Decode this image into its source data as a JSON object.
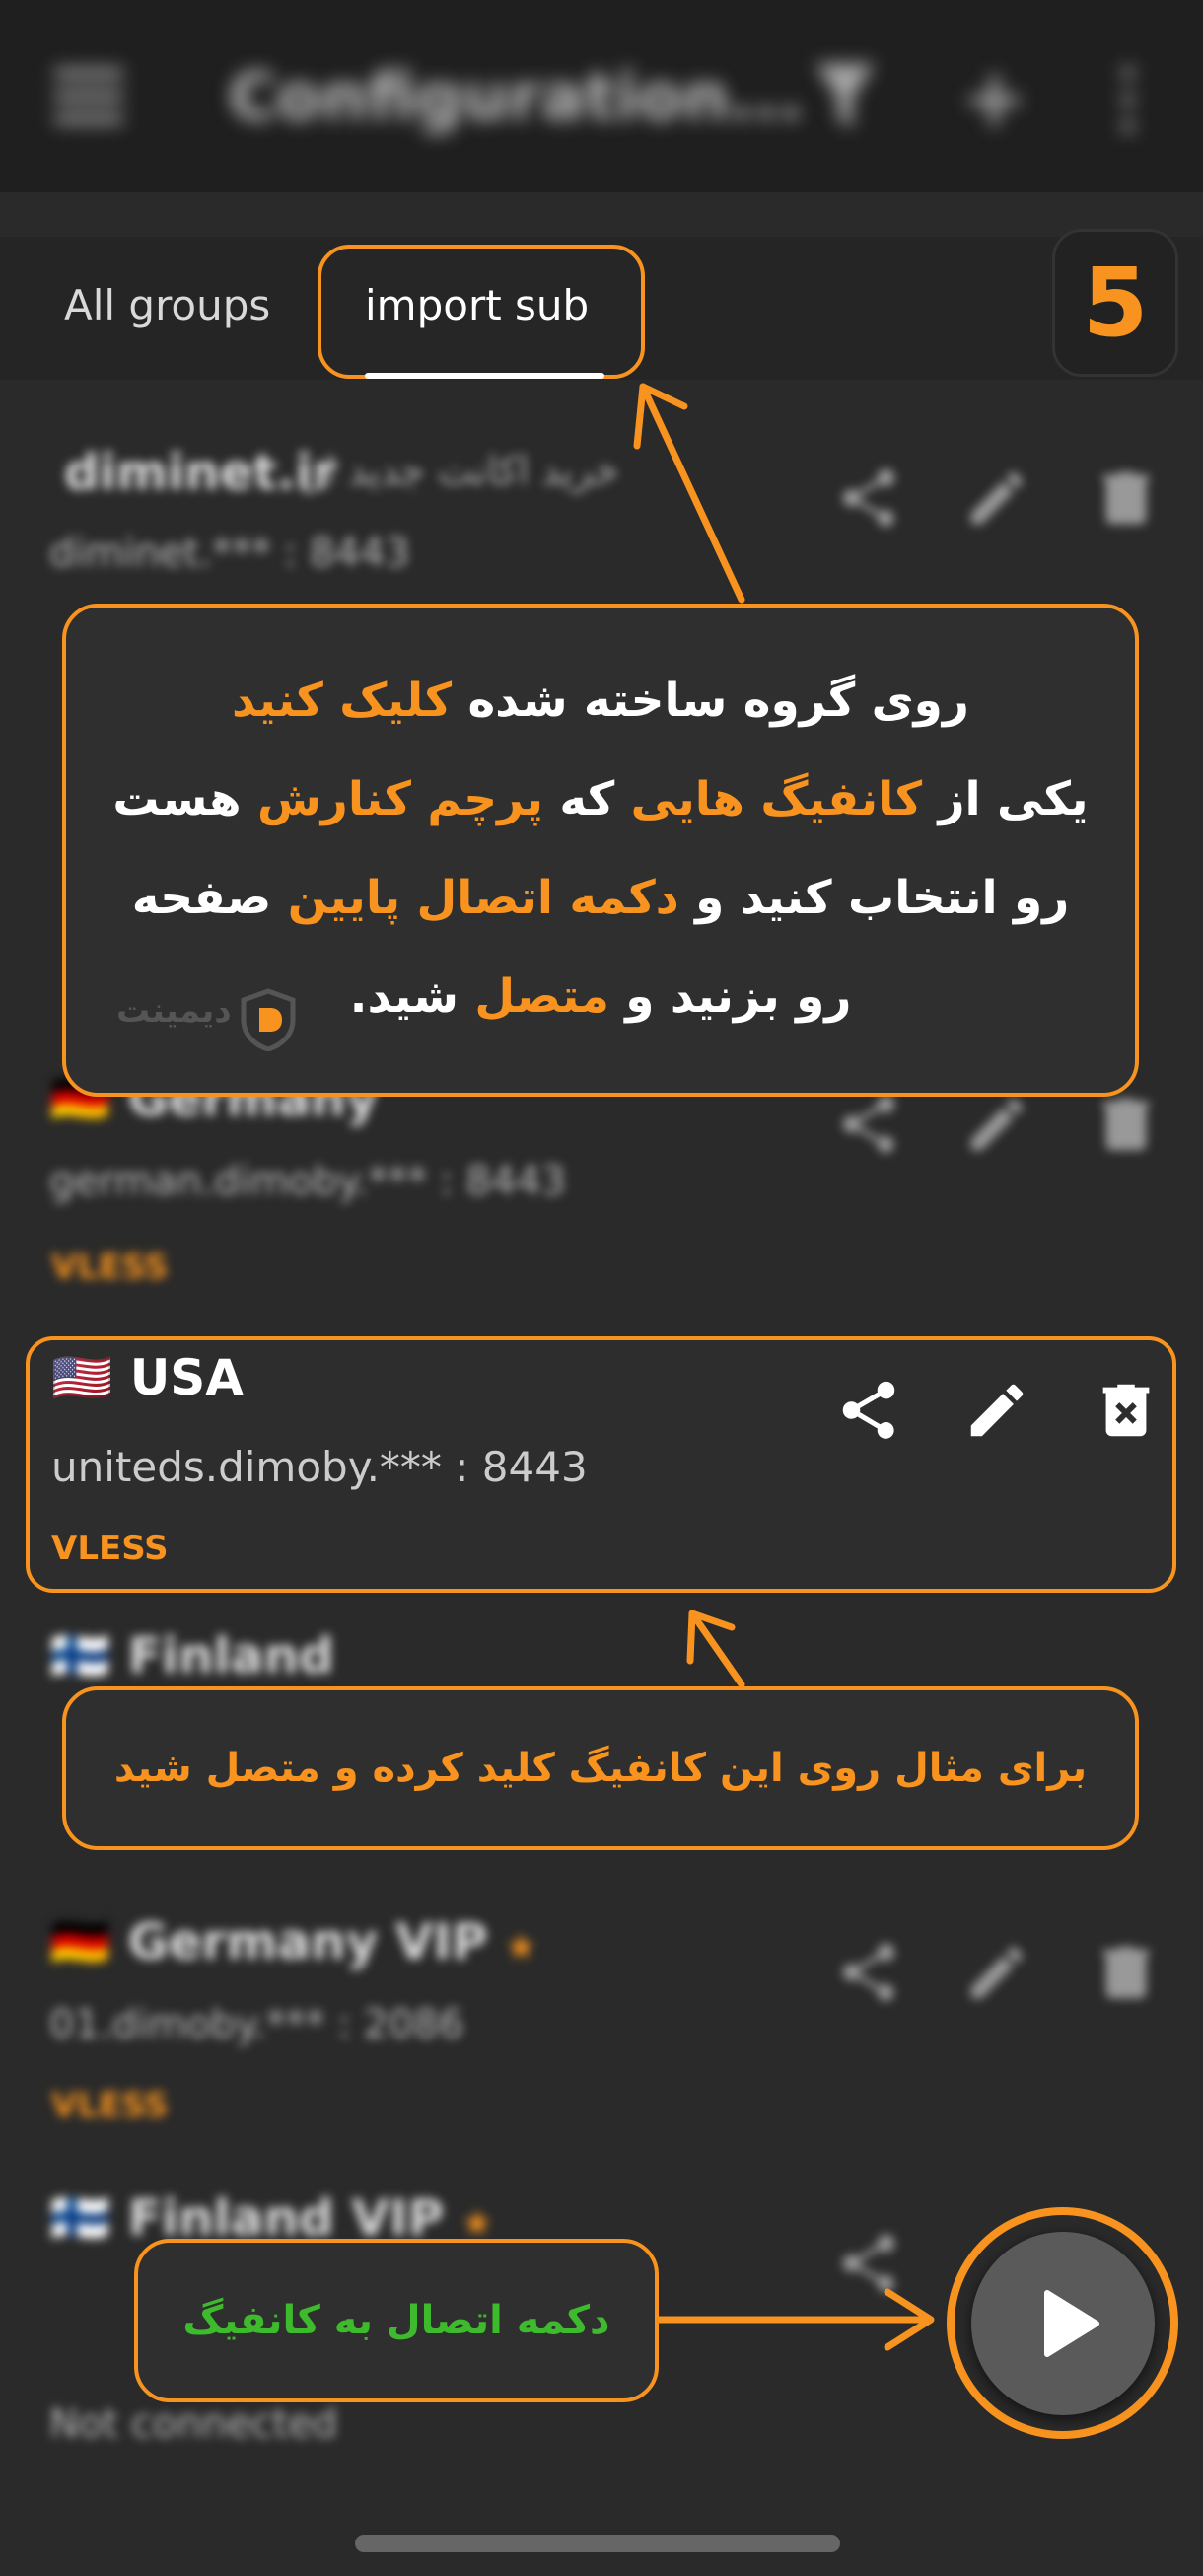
{
  "app_bar": {
    "title": "Configuration...",
    "icons": [
      "menu-icon",
      "filter-icon",
      "add-icon",
      "more-icon"
    ]
  },
  "tabs": [
    {
      "label": "All groups",
      "selected": false
    },
    {
      "label": "import sub",
      "selected": true
    }
  ],
  "step_number": "5",
  "rows": [
    {
      "name": "diminet.ir",
      "note": "خرید اکانت جدید از",
      "address": "diminet.*** : 8443"
    },
    {
      "name": "Germany",
      "flag": "🇩🇪",
      "address": "german.dimoby.*** : 8443",
      "type": "VLESS"
    },
    {
      "name": "USA",
      "flag": "🇺🇸",
      "address": "uniteds.dimoby.*** : 8443",
      "type": "VLESS"
    },
    {
      "name": "Finland",
      "flag": "🇫🇮"
    },
    {
      "name": "Germany VIP",
      "flag": "🇩🇪",
      "address": "01.dimoby.*** : 2086",
      "type": "VLESS"
    },
    {
      "name": "Finland VIP",
      "flag": "🇫🇮",
      "status": "Not connected"
    }
  ],
  "callout_main": {
    "line1_a": "روی گروه ساخته شده ",
    "line1_b": "کلیک کنید",
    "line2_a": "یکی از ",
    "line2_b": "کانفیگ هایی",
    "line2_c": " که ",
    "line2_d": "پرچم کنارش",
    "line2_e": " هست",
    "line3_a": "رو انتخاب کنید و ",
    "line3_b": "دکمه اتصال پایین",
    "line3_c": " صفحه",
    "line4_a": "رو بزنید و ",
    "line4_b": "متصل",
    "line4_c": " شید."
  },
  "callout_example": "برای مثال روی این کانفیگ کلید کرده و متصل شید",
  "callout_connect": "دکمه اتصال به کانفیگ",
  "brand_logo": "دیمینت",
  "colors": {
    "accent": "#f7931e",
    "green": "#3dbb2c",
    "background": "#2a2a2a"
  }
}
